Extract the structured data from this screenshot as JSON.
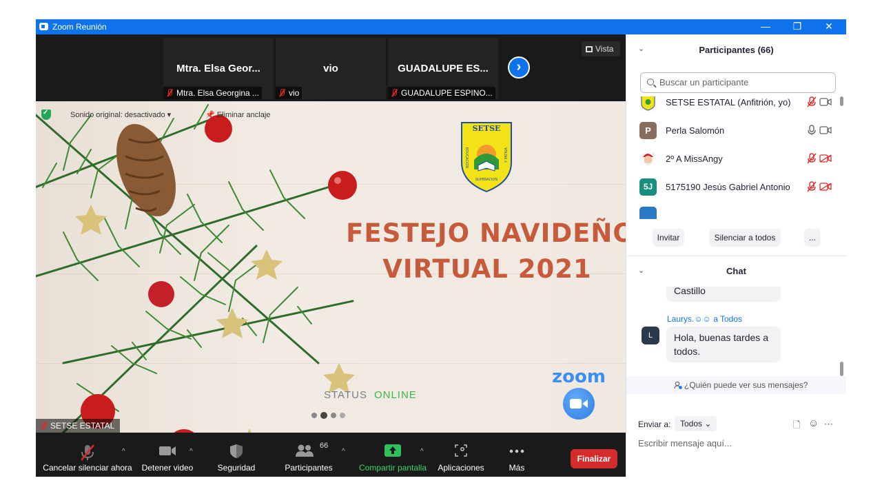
{
  "window": {
    "title": "Zoom Reunión",
    "controls": [
      "—",
      "❐",
      "✕"
    ]
  },
  "thumbnails": [
    {
      "big": "Mtra. Elsa Geor...",
      "footer": "Mtra. Elsa Georgina ..."
    },
    {
      "big": "vio",
      "footer": "vio"
    },
    {
      "big": "GUADALUPE ES...",
      "footer": "GUADALUPE ESPINO..."
    }
  ],
  "view_button": "Vista",
  "next_arrow": "›",
  "share": {
    "sound_label": "Sonido original: desactivado",
    "sound_caret": "▾",
    "pin_label": "Eliminar anclaje",
    "pin_icon": "📌",
    "logo_letters": "SETSE",
    "logo_left": "EDUCACION",
    "logo_right": "Y PATRIA",
    "logo_bottom": "SUPERACION",
    "title_line1": "FESTEJO NAVIDEÑO",
    "title_line2": "VIRTUAL 2021",
    "status_word": "STATUS",
    "status_value": "ONLINE",
    "zoom_watermark": "zoom",
    "sharer_label": "SETSE ESTATAL"
  },
  "toolbar": {
    "mute": "Cancelar silenciar ahora",
    "video": "Detener video",
    "security": "Seguridad",
    "participants": "Participantes",
    "participants_count": "66",
    "share": "Compartir pantalla",
    "apps": "Aplicaciones",
    "more": "Más",
    "end": "Finalizar",
    "caret": "^"
  },
  "participants_panel": {
    "collapse": "⌄",
    "title": "Participantes (66)",
    "search_placeholder": "Buscar un participante",
    "items": [
      {
        "name": "SETSE ESTATAL (Anfitrión, yo)",
        "avatar": "",
        "color": "#f7f7f7",
        "mic": "muted",
        "video": "on"
      },
      {
        "name": "Perla Salomón",
        "avatar": "P",
        "color": "#8a6c5e",
        "mic": "on",
        "video": "on"
      },
      {
        "name": "2º A  MissAngy",
        "avatar": "",
        "color": "#ffffff",
        "mic": "muted",
        "video": "off"
      },
      {
        "name": "5175190 Jesús Gabriel Antonio",
        "avatar": "5J",
        "color": "#178f7f",
        "mic": "muted",
        "video": "off"
      }
    ],
    "buttons": {
      "invite": "Invitar",
      "mute_all": "Silenciar a todos",
      "more": "..."
    }
  },
  "chat_panel": {
    "collapse": "⌄",
    "title": "Chat",
    "prev_message_tail": "Castillo",
    "messages": [
      {
        "sender": "Laurys.☺☺",
        "to": "a Todos",
        "avatar": "L",
        "text_line1": "Hola, buenas tardes a",
        "text_line2": "todos."
      }
    ],
    "who_can_see": "¿Quién puede ver sus mensajes?",
    "send_to_label": "Enviar a:",
    "send_to_value": "Todos",
    "send_to_caret": "⌄",
    "input_placeholder": "Escribir mensaje aquí...",
    "file_icon": "🗋",
    "emoji_icon": "☺",
    "more_icon": "⋯"
  }
}
